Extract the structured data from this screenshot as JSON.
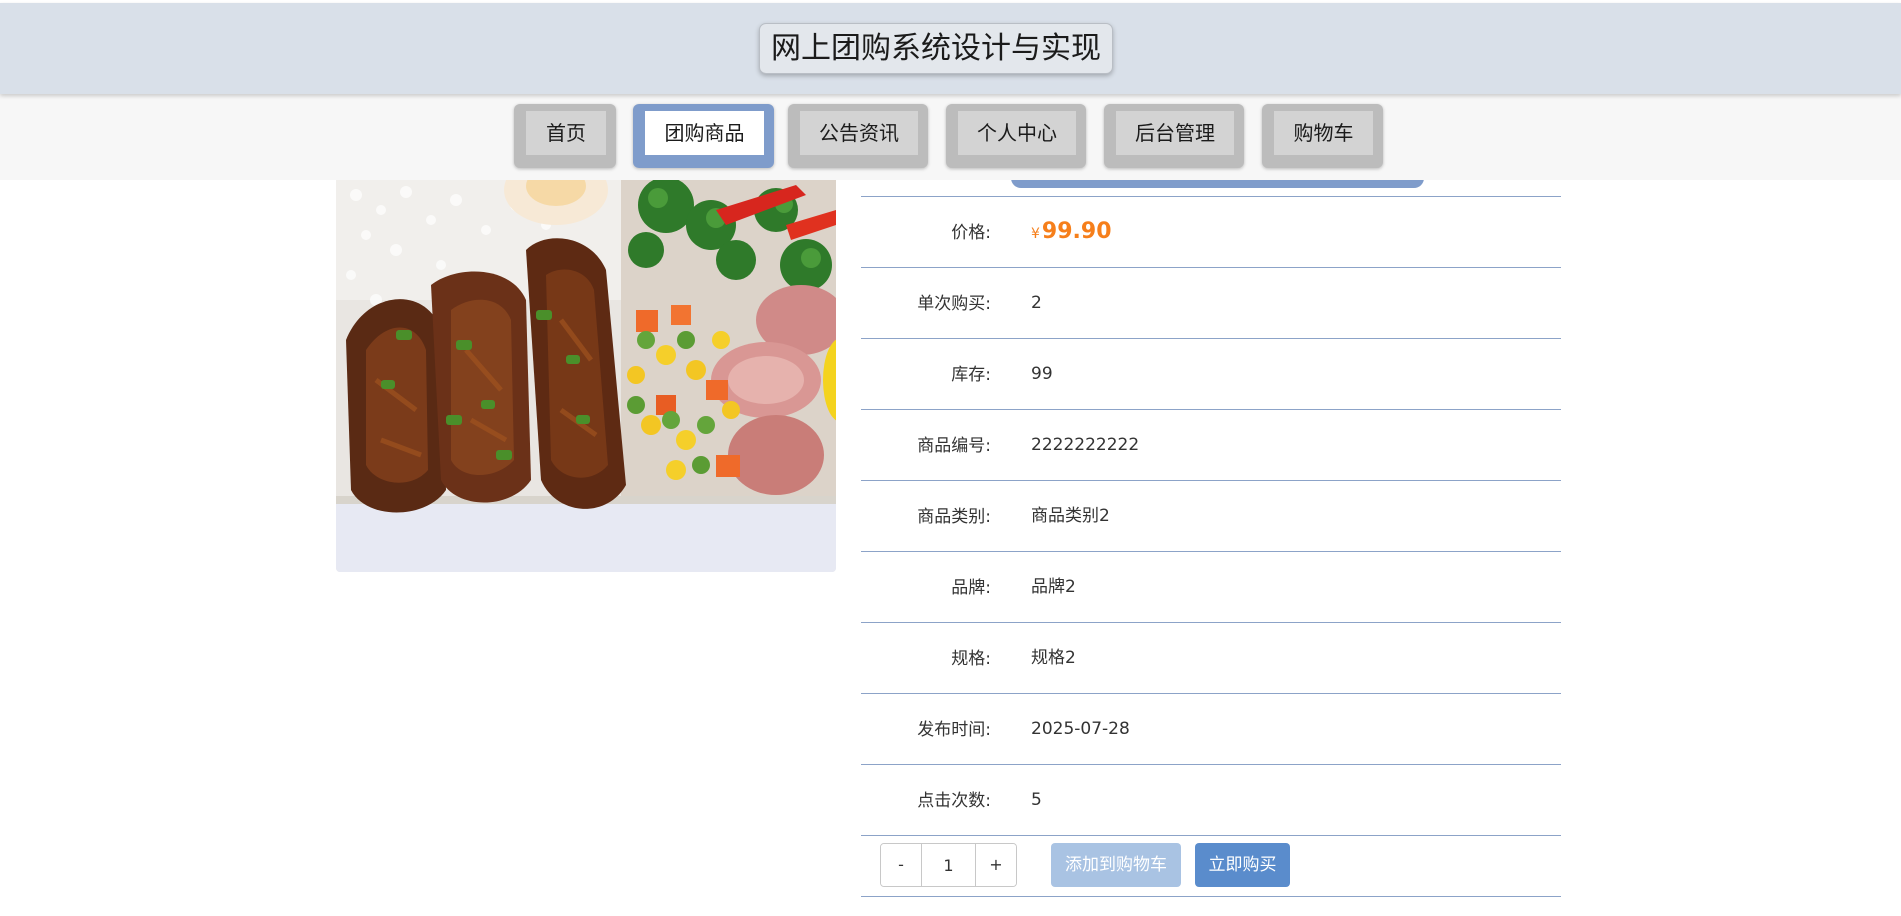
{
  "header": {
    "title": "网上团购系统设计与实现"
  },
  "nav": {
    "items": [
      {
        "label": "首页"
      },
      {
        "label": "团购商品"
      },
      {
        "label": "公告资讯"
      },
      {
        "label": "个人中心"
      },
      {
        "label": "后台管理"
      },
      {
        "label": "购物车"
      }
    ],
    "active_index": 1
  },
  "product": {
    "price_label": "价格:",
    "price_currency": "¥",
    "price_value": "99.90",
    "rows": [
      {
        "label": "单次购买:",
        "value": "2"
      },
      {
        "label": "库存:",
        "value": "99"
      },
      {
        "label": "商品编号:",
        "value": "2222222222"
      },
      {
        "label": "商品类别:",
        "value": "商品类别2"
      },
      {
        "label": "品牌:",
        "value": "品牌2"
      },
      {
        "label": "规格:",
        "value": "规格2"
      },
      {
        "label": "发布时间:",
        "value": "2025-07-28"
      },
      {
        "label": "点击次数:",
        "value": "5"
      }
    ]
  },
  "actions": {
    "minus_label": "-",
    "quantity": "1",
    "plus_label": "+",
    "add_to_cart_label": "添加到购物车",
    "buy_now_label": "立即购买"
  },
  "colors": {
    "header_bg": "#d9e0e9",
    "nav_active": "#7f9ccb",
    "price": "#f67f1b",
    "buy_button": "#5a8ccc",
    "cart_button": "#a9c3e3",
    "divider": "#8ca3c8"
  }
}
